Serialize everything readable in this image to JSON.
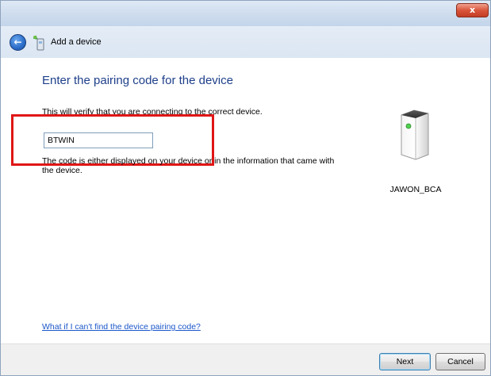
{
  "window": {
    "close_label": "x"
  },
  "nav": {
    "back_glyph": "←",
    "title": "Add a device"
  },
  "main": {
    "heading": "Enter the pairing code for the device",
    "subtext": "This will verify that you are connecting to the correct device.",
    "code_value": "BTWIN",
    "help_text": "The code is either displayed on your device or in the information that came with the device.",
    "device_name": "JAWON_BCA",
    "help_link": "What if I can't find the device pairing code?"
  },
  "footer": {
    "next_label": "Next",
    "cancel_label": "Cancel"
  },
  "colors": {
    "heading": "#1e3f8a",
    "link": "#1a56c9",
    "highlight": "#e01616"
  },
  "icons": {
    "back": "back-arrow-icon",
    "wizard": "add-device-icon",
    "device": "device-tower-icon"
  }
}
